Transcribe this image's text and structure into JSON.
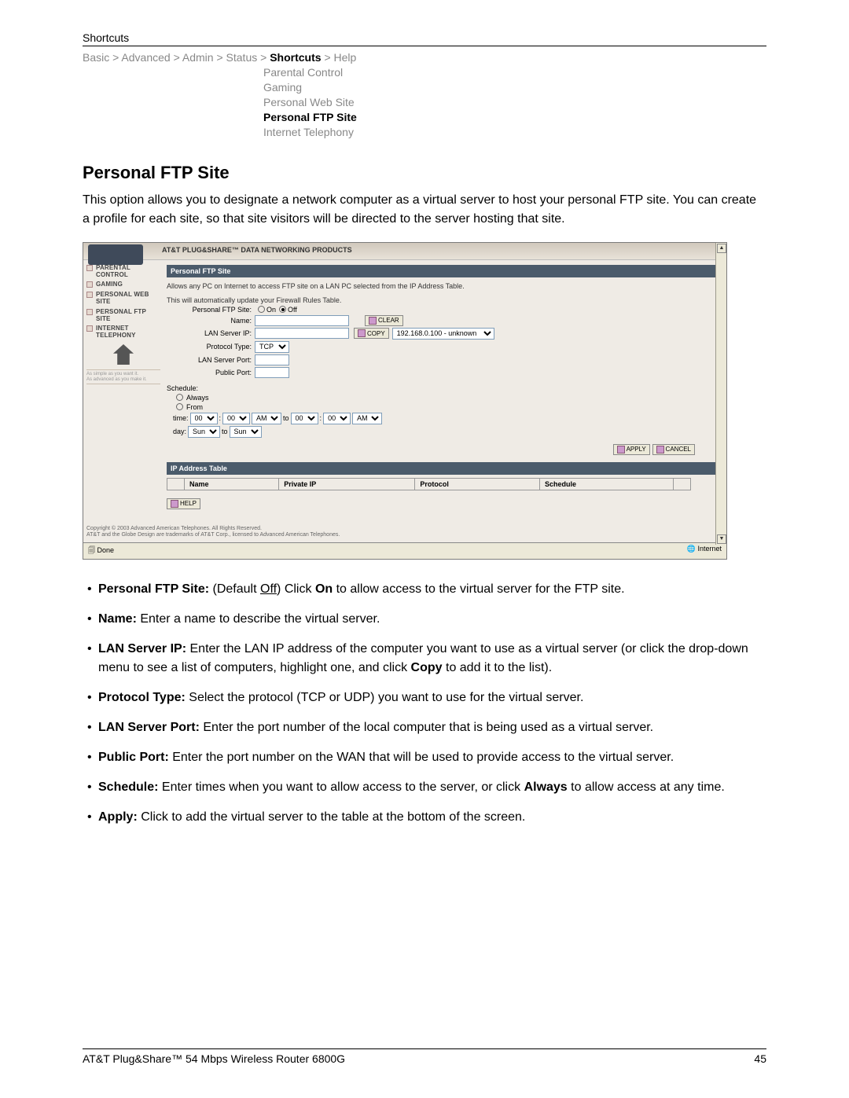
{
  "header": {
    "section": "Shortcuts"
  },
  "breadcrumb": {
    "basic": "Basic",
    "advanced": "Advanced",
    "admin": "Admin",
    "status": "Status",
    "shortcuts": "Shortcuts",
    "help": "Help",
    "sep": " > "
  },
  "submenu": {
    "parental": "Parental Control",
    "gaming": "Gaming",
    "web": "Personal Web Site",
    "ftp": "Personal FTP Site",
    "tel": "Internet Telephony"
  },
  "title": "Personal FTP Site",
  "intro": "This option allows you to designate a network computer as a virtual server to host your personal FTP site. You can create a profile for each site, so that site visitors will be directed to the server hosting that site.",
  "shot": {
    "brand": "AT&T PLUG&SHARE™ DATA NETWORKING PRODUCTS",
    "sidebar": {
      "items": [
        "PARENTAL CONTROL",
        "GAMING",
        "PERSONAL WEB SITE",
        "PERSONAL FTP SITE",
        "INTERNET TELEPHONY"
      ],
      "tag1": "As simple as you want it.",
      "tag2": "As advanced as you make it."
    },
    "panel_title": "Personal FTP Site",
    "panel_desc": "Allows any PC on Internet to access FTP site on a LAN PC selected from the IP Address Table.",
    "firewall_note": "This will automatically update your Firewall Rules Table.",
    "toggle": {
      "label": "Personal FTP Site:",
      "on": "On",
      "off": "Off"
    },
    "fields": {
      "name": "Name:",
      "lanip": "LAN Server IP:",
      "proto": "Protocol Type:",
      "proto_val": "TCP",
      "lanport": "LAN Server Port:",
      "pubport": "Public Port:",
      "clear": "CLEAR",
      "copy": "COPY",
      "ip_select": "192.168.0.100 - unknown"
    },
    "schedule": {
      "label": "Schedule:",
      "always": "Always",
      "from": "From",
      "time": "time:",
      "to": "to",
      "day": "day:",
      "h": "00",
      "m": "00",
      "ampm": "AM",
      "dayv": "Sun"
    },
    "buttons": {
      "apply": "APPLY",
      "cancel": "CANCEL",
      "help": "HELP"
    },
    "ip_title": "IP Address Table",
    "cols": {
      "name": "Name",
      "pip": "Private IP",
      "proto": "Protocol",
      "sched": "Schedule"
    },
    "copyright1": "Copyright © 2003 Advanced American Telephones. All Rights Reserved.",
    "copyright2": "AT&T and the Globe Design are trademarks of AT&T Corp., licensed to Advanced American Telephones.",
    "status_done": "Done",
    "status_net": "Internet"
  },
  "bullets": {
    "b_pfs_1": "Personal FTP Site:",
    "b_pfs_2": " (Default ",
    "b_pfs_off": "Off",
    "b_pfs_3": ") Click ",
    "b_pfs_on": "On",
    "b_pfs_4": " to allow access to the virtual server for the FTP site.",
    "b_name_1": "Name:",
    "b_name_2": " Enter a name to describe the virtual server.",
    "b_lan_1": "LAN Server IP:",
    "b_lan_2": " Enter the LAN IP address of the computer you want to use as a virtual server (or click the drop-down menu to see a list of computers, highlight one, and click ",
    "b_lan_copy": "Copy",
    "b_lan_3": " to add it to the list).",
    "b_pt_1": "Protocol Type:",
    "b_pt_2": " Select the protocol (TCP or UDP) you want to use for the virtual server.",
    "b_lsp_1": "LAN Server Port:",
    "b_lsp_2": " Enter the port number of the local computer that is being used as a virtual server.",
    "b_pp_1": "Public Port:",
    "b_pp_2": " Enter the port number on the WAN that will be used to provide access to the virtual server.",
    "b_sch_1": "Schedule:",
    "b_sch_2": " Enter times when you want to allow access to the server, or click ",
    "b_sch_always": "Always",
    "b_sch_3": " to allow access at any time.",
    "b_ap_1": "Apply:",
    "b_ap_2": " Click to add the virtual server to the table at the bottom of the screen."
  },
  "footer": {
    "product": "AT&T Plug&Share™ 54 Mbps Wireless Router 6800G",
    "page": "45"
  }
}
